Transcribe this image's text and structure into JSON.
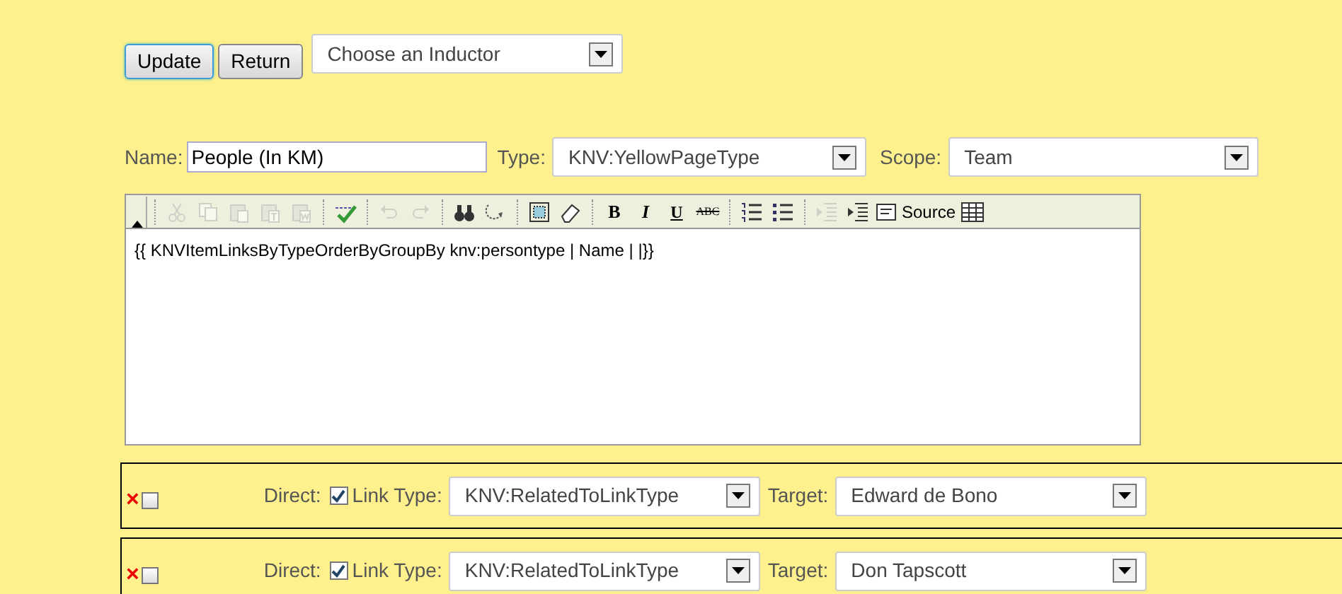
{
  "actions": {
    "buttons": [
      {
        "label": "Update",
        "focused": true
      },
      {
        "label": "Return",
        "focused": false
      }
    ],
    "inductor": {
      "value": "Choose an Inductor"
    }
  },
  "fields": {
    "name": {
      "label": "Name:",
      "value": "People (In KM)"
    },
    "type": {
      "label": "Type:",
      "value": "KNV:YellowPageType"
    },
    "scope": {
      "label": "Scope:",
      "value": "Team"
    }
  },
  "toolbar": [
    {
      "kind": "collapse"
    },
    {
      "kind": "separator"
    },
    {
      "kind": "cut",
      "disabled": true
    },
    {
      "kind": "copy",
      "disabled": true
    },
    {
      "kind": "paste",
      "disabled": true
    },
    {
      "kind": "paste-text",
      "disabled": true
    },
    {
      "kind": "paste-word",
      "disabled": true
    },
    {
      "kind": "separator"
    },
    {
      "kind": "spellcheck",
      "disabled": false
    },
    {
      "kind": "separator"
    },
    {
      "kind": "undo",
      "disabled": true
    },
    {
      "kind": "redo",
      "disabled": true
    },
    {
      "kind": "separator"
    },
    {
      "kind": "find",
      "disabled": false
    },
    {
      "kind": "replace",
      "disabled": false
    },
    {
      "kind": "separator"
    },
    {
      "kind": "select-all",
      "disabled": false
    },
    {
      "kind": "eraser",
      "disabled": false
    },
    {
      "kind": "separator"
    },
    {
      "kind": "bold",
      "label": "B",
      "disabled": false
    },
    {
      "kind": "italic",
      "label": "I",
      "disabled": false
    },
    {
      "kind": "underline",
      "label": "U",
      "disabled": false
    },
    {
      "kind": "strike",
      "label": "ABC",
      "disabled": false
    },
    {
      "kind": "separator"
    },
    {
      "kind": "ordered-list",
      "disabled": false
    },
    {
      "kind": "bullet-list",
      "disabled": false
    },
    {
      "kind": "separator"
    },
    {
      "kind": "outdent",
      "disabled": true
    },
    {
      "kind": "indent",
      "disabled": false
    },
    {
      "kind": "source",
      "label": "Source",
      "disabled": false
    },
    {
      "kind": "table",
      "disabled": false
    }
  ],
  "editor": {
    "content": "{{ KNVItemLinksByTypeOrderByGroupBy knv:persontype | Name | |}}"
  },
  "links": [
    {
      "remove": "×",
      "selected": false,
      "direct_label": "Direct:",
      "direct": true,
      "link_type_label": "Link Type:",
      "link_type": "KNV:RelatedToLinkType",
      "target_label": "Target:",
      "target": "Edward de Bono"
    },
    {
      "remove": "×",
      "selected": false,
      "direct_label": "Direct:",
      "direct": true,
      "link_type_label": "Link Type:",
      "link_type": "KNV:RelatedToLinkType",
      "target_label": "Target:",
      "target": "Don Tapscott"
    }
  ]
}
